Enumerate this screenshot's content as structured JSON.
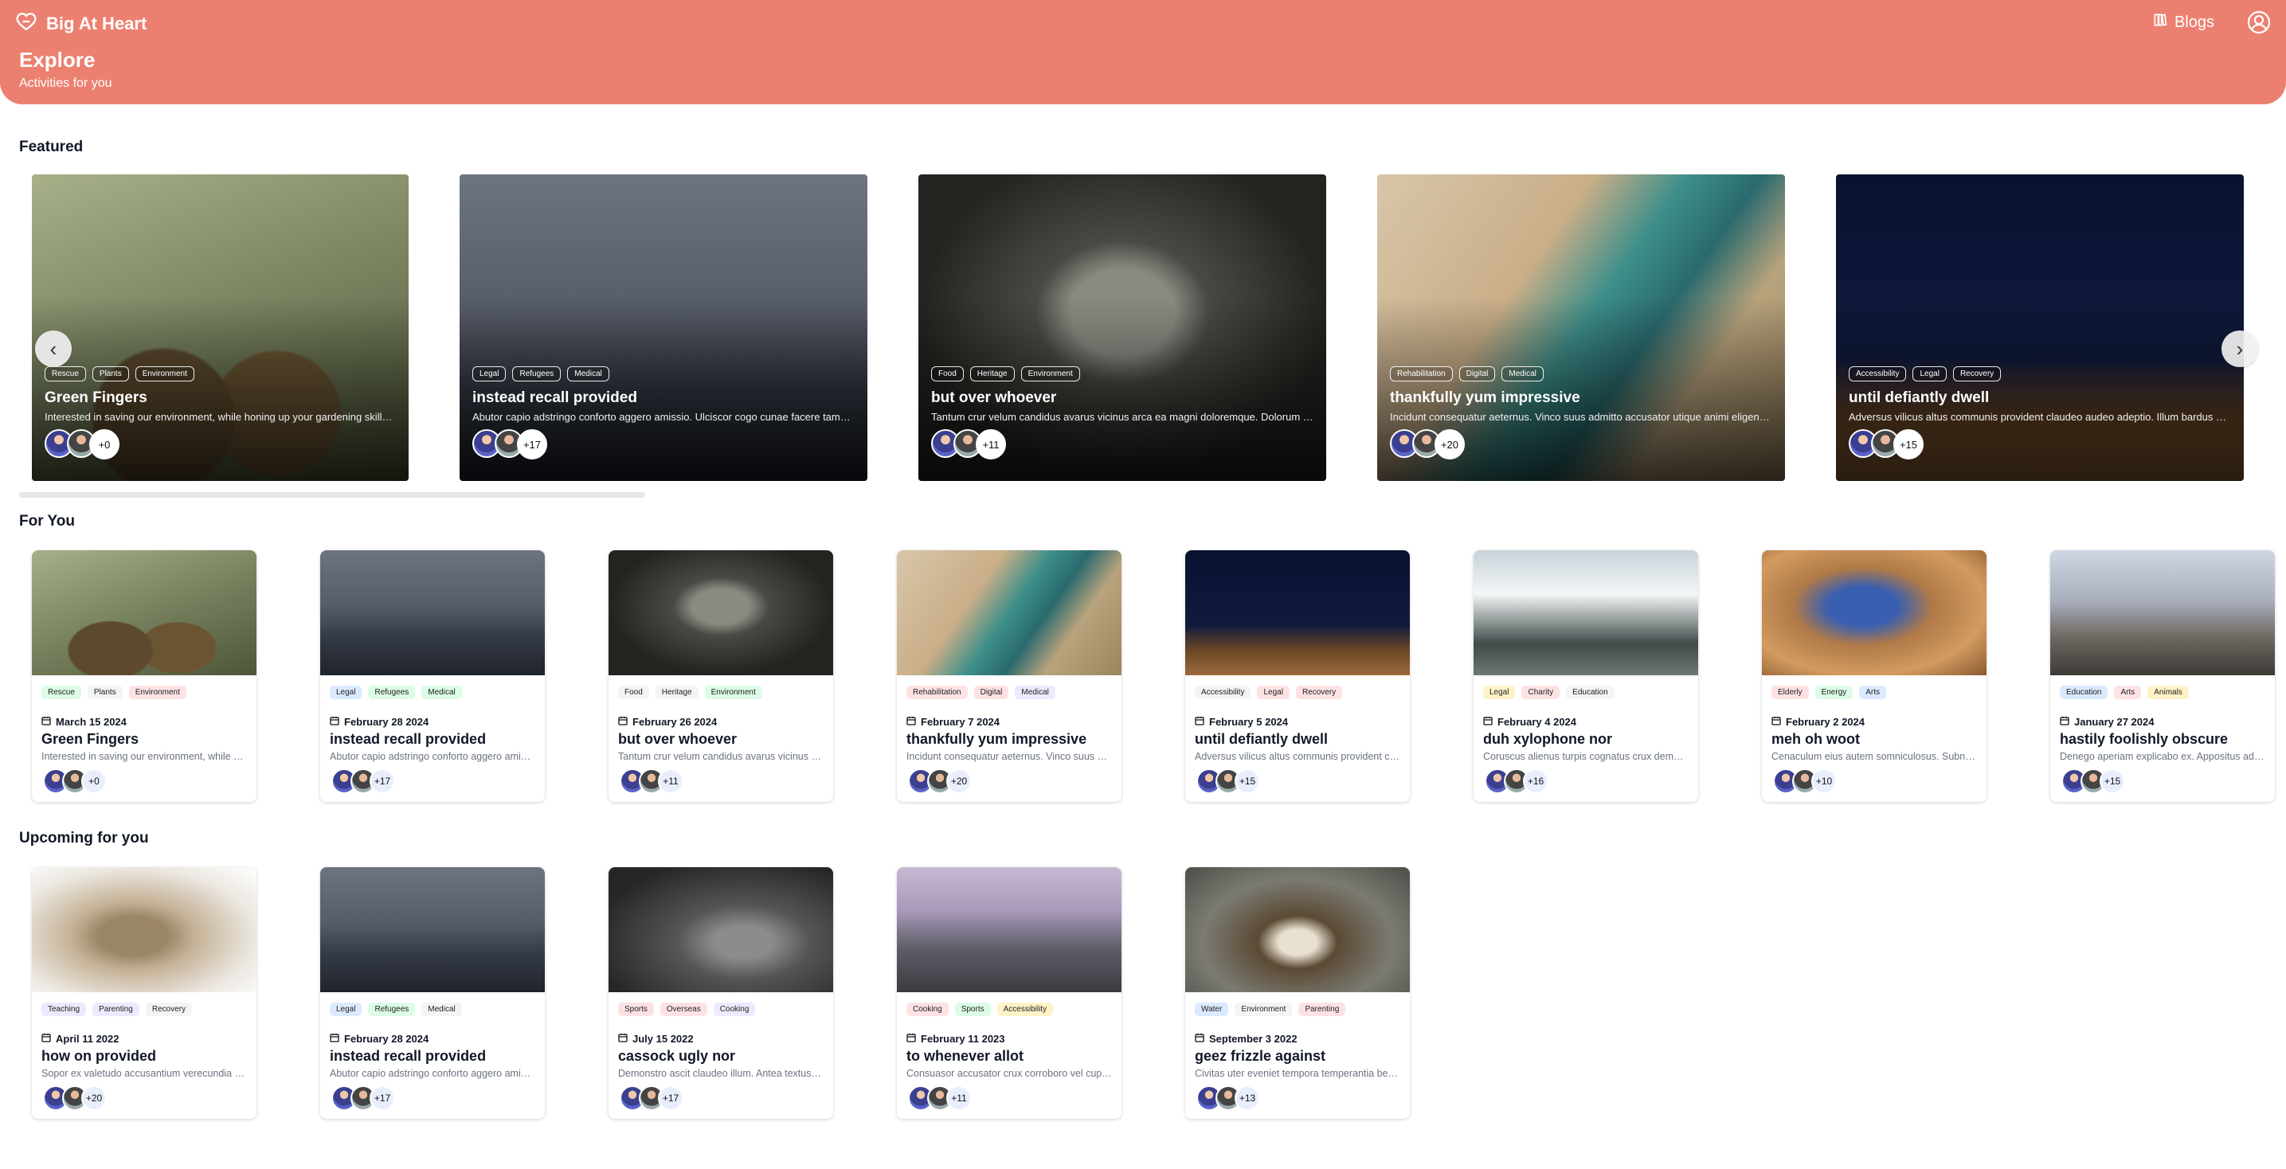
{
  "header": {
    "brand": "Big At Heart",
    "blogs_label": "Blogs",
    "title": "Explore",
    "subtitle": "Activities for you",
    "background": "#ec8070"
  },
  "sections": {
    "featured": "Featured",
    "for_you": "For You",
    "upcoming": "Upcoming for you"
  },
  "featured": [
    {
      "name": "Green Fingers",
      "tags": [
        "Rescue",
        "Plants",
        "Environment"
      ],
      "desc": "Interested in saving our environment, while honing up your gardening skills? ...",
      "count": "+0",
      "image": "plants"
    },
    {
      "name": "instead recall provided",
      "tags": [
        "Legal",
        "Refugees",
        "Medical"
      ],
      "desc": "Abutor capio adstringo conforto aggero amissio. Ulciscor cogo cunae facere tametsi.",
      "count": "+17",
      "image": "ocean"
    },
    {
      "name": "but over whoever",
      "tags": [
        "Food",
        "Heritage",
        "Environment"
      ],
      "desc": "Tantum crur velum candidus avarus vicinus arca ea magni doloremque. Dolorum terr...",
      "count": "+11",
      "image": "kitten"
    },
    {
      "name": "thankfully yum impressive",
      "tags": [
        "Rehabilitation",
        "Digital",
        "Medical"
      ],
      "desc": "Incidunt consequatur aeternus. Vinco suus admitto accusator utique animi eligendi...",
      "count": "+20",
      "image": "beach"
    },
    {
      "name": "until defiantly dwell",
      "tags": [
        "Accessibility",
        "Legal",
        "Recovery"
      ],
      "desc": "Adversus vilicus altus communis provident claudeo audeo adeptio. Illum bardus dem...",
      "count": "+15",
      "image": "night"
    }
  ],
  "for_you": [
    {
      "name": "Green Fingers",
      "date": "March 15 2024",
      "tags": [
        {
          "label": "Rescue",
          "color": "green"
        },
        {
          "label": "Plants",
          "color": "gray"
        },
        {
          "label": "Environment",
          "color": "red"
        }
      ],
      "desc": "Interested in saving our environment, while honing up your gardening skills?",
      "count": "+0",
      "image": "plants"
    },
    {
      "name": "instead recall provided",
      "date": "February 28 2024",
      "tags": [
        {
          "label": "Legal",
          "color": "blue"
        },
        {
          "label": "Refugees",
          "color": "green"
        },
        {
          "label": "Medical",
          "color": "green"
        }
      ],
      "desc": "Abutor capio adstringo conforto aggero amissio. Ulciscor cogo cunae facere tametsi.",
      "count": "+17",
      "image": "ocean"
    },
    {
      "name": "but over whoever",
      "date": "February 26 2024",
      "tags": [
        {
          "label": "Food",
          "color": "gray"
        },
        {
          "label": "Heritage",
          "color": "gray"
        },
        {
          "label": "Environment",
          "color": "green"
        }
      ],
      "desc": "Tantum crur velum candidus avarus vicinus arca ea magni doloremque.",
      "count": "+11",
      "image": "kitten"
    },
    {
      "name": "thankfully yum impressive",
      "date": "February 7 2024",
      "tags": [
        {
          "label": "Rehabilitation",
          "color": "red"
        },
        {
          "label": "Digital",
          "color": "red"
        },
        {
          "label": "Medical",
          "color": "purple"
        }
      ],
      "desc": "Incidunt consequatur aeternus. Vinco suus admitto accusator utique animi eligendi.",
      "count": "+20",
      "image": "beach"
    },
    {
      "name": "until defiantly dwell",
      "date": "February 5 2024",
      "tags": [
        {
          "label": "Accessibility",
          "color": "gray"
        },
        {
          "label": "Legal",
          "color": "red"
        },
        {
          "label": "Recovery",
          "color": "red"
        }
      ],
      "desc": "Adversus vilicus altus communis provident claudeo audeo adeptio.",
      "count": "+15",
      "image": "night"
    },
    {
      "name": "duh xylophone nor",
      "date": "February 4 2024",
      "tags": [
        {
          "label": "Legal",
          "color": "yellow"
        },
        {
          "label": "Charity",
          "color": "red"
        },
        {
          "label": "Education",
          "color": "gray"
        }
      ],
      "desc": "Coruscus alienus turpis cognatus crux demoror.",
      "count": "+16",
      "image": "wave"
    },
    {
      "name": "meh oh woot",
      "date": "February 2 2024",
      "tags": [
        {
          "label": "Elderly",
          "color": "red"
        },
        {
          "label": "Energy",
          "color": "green"
        },
        {
          "label": "Arts",
          "color": "blue"
        }
      ],
      "desc": "Cenaculum eius autem somniculosus. Subnecto vero.",
      "count": "+10",
      "image": "orange"
    },
    {
      "name": "hastily foolishly obscure",
      "date": "January 27 2024",
      "tags": [
        {
          "label": "Education",
          "color": "blue"
        },
        {
          "label": "Arts",
          "color": "red"
        },
        {
          "label": "Animals",
          "color": "yellow"
        }
      ],
      "desc": "Denego aperiam explicabo ex. Appositus admoveo.",
      "count": "+15",
      "image": "cat"
    }
  ],
  "upcoming": [
    {
      "name": "how on provided",
      "date": "April 11 2022",
      "tags": [
        {
          "label": "Teaching",
          "color": "purple"
        },
        {
          "label": "Parenting",
          "color": "purple"
        },
        {
          "label": "Recovery",
          "color": "gray"
        }
      ],
      "desc": "Sopor ex valetudo accusantium verecundia tepesco.",
      "count": "+20",
      "image": "leopardcat"
    },
    {
      "name": "instead recall provided",
      "date": "February 28 2024",
      "tags": [
        {
          "label": "Legal",
          "color": "blue"
        },
        {
          "label": "Refugees",
          "color": "green"
        },
        {
          "label": "Medical",
          "color": "gray"
        }
      ],
      "desc": "Abutor capio adstringo conforto aggero amissio. Ulciscor cogo cunae facere tametsi.",
      "count": "+17",
      "image": "ocean"
    },
    {
      "name": "cassock ugly nor",
      "date": "July 15 2022",
      "tags": [
        {
          "label": "Sports",
          "color": "red"
        },
        {
          "label": "Overseas",
          "color": "red"
        },
        {
          "label": "Cooking",
          "color": "purple"
        }
      ],
      "desc": "Demonstro ascit claudeo illum. Antea textus tamen.",
      "count": "+17",
      "image": "bwcat"
    },
    {
      "name": "to whenever allot",
      "date": "February 11 2023",
      "tags": [
        {
          "label": "Cooking",
          "color": "red"
        },
        {
          "label": "Sports",
          "color": "green"
        },
        {
          "label": "Accessibility",
          "color": "yellow"
        }
      ],
      "desc": "Consuasor accusator crux corroboro vel cupiditas.",
      "count": "+11",
      "image": "mountain"
    },
    {
      "name": "geez frizzle against",
      "date": "September 3 2022",
      "tags": [
        {
          "label": "Water",
          "color": "blue"
        },
        {
          "label": "Environment",
          "color": "gray"
        },
        {
          "label": "Parenting",
          "color": "red"
        }
      ],
      "desc": "Civitas uter eveniet tempora temperantia benevolentia.",
      "count": "+13",
      "image": "calico"
    }
  ]
}
